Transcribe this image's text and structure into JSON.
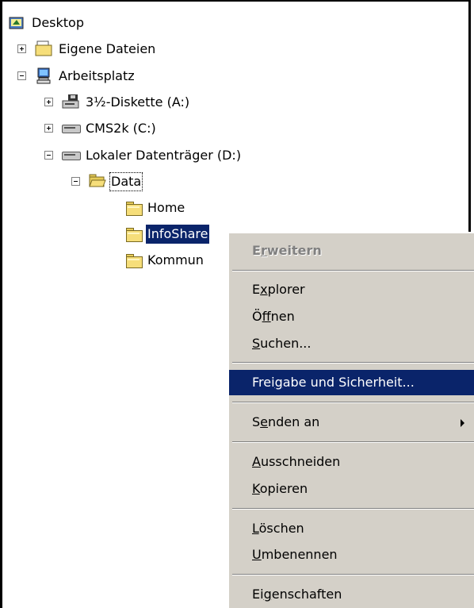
{
  "tree": {
    "desktop": "Desktop",
    "eigene_dateien": "Eigene Dateien",
    "arbeitsplatz": "Arbeitsplatz",
    "diskette": "3½-Diskette (A:)",
    "cms2k": "CMS2k (C:)",
    "lokaler": "Lokaler Datenträger (D:)",
    "data": "Data",
    "home": "Home",
    "infoshare": "InfoShare",
    "kommun": "Kommun"
  },
  "menu": {
    "items": [
      {
        "pre": "E",
        "u": "r",
        "post": "weitern"
      },
      {
        "pre": "E",
        "u": "x",
        "post": "plorer"
      },
      {
        "pre": "Ö",
        "u": "f",
        "post": "fnen"
      },
      {
        "pre": "",
        "u": "S",
        "post": "uchen..."
      },
      {
        "pre": "Frei",
        "u": "g",
        "post": "abe und Sicherheit..."
      },
      {
        "pre": "S",
        "u": "e",
        "post": "nden an"
      },
      {
        "pre": "",
        "u": "A",
        "post": "usschneiden"
      },
      {
        "pre": "",
        "u": "K",
        "post": "opieren"
      },
      {
        "pre": "",
        "u": "L",
        "post": "öschen"
      },
      {
        "pre": "",
        "u": "U",
        "post": "mbenennen"
      },
      {
        "pre": "Ei",
        "u": "g",
        "post": "enschaften"
      }
    ]
  },
  "colors": {
    "selection": "#0a246a",
    "menu_bg": "#d4d0c8"
  }
}
